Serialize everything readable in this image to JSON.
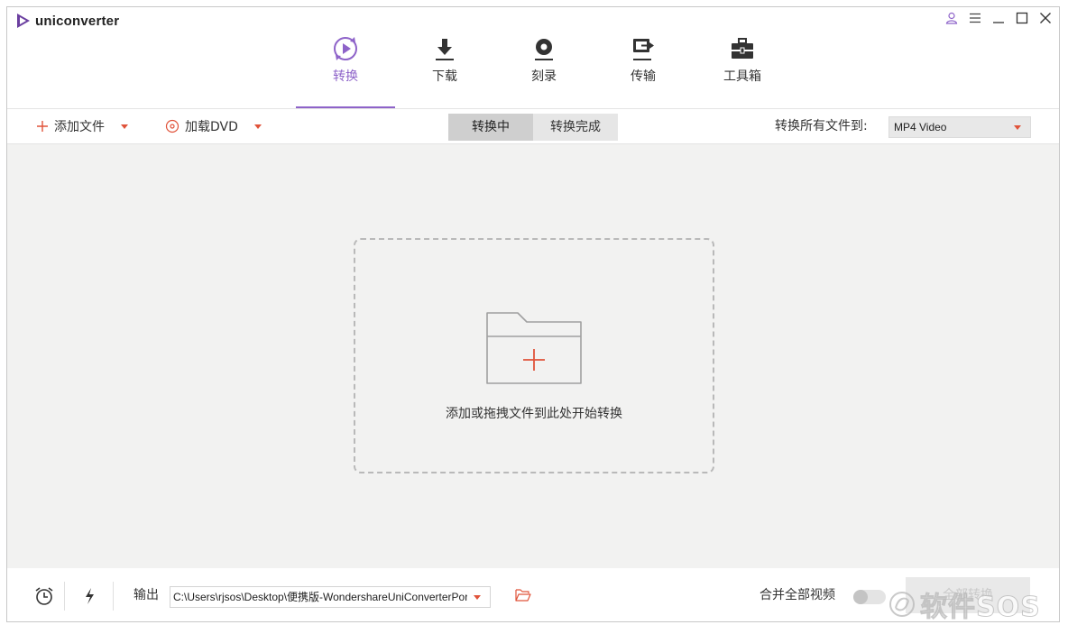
{
  "app": {
    "title": "uniconverter"
  },
  "colors": {
    "accent": "#8e63c9",
    "caret": "#e0533a",
    "plus": "#e0533a"
  },
  "window_controls": [
    {
      "name": "account-icon"
    },
    {
      "name": "menu-icon"
    },
    {
      "name": "minimize-icon"
    },
    {
      "name": "maximize-icon"
    },
    {
      "name": "close-icon"
    }
  ],
  "nav": {
    "items": [
      {
        "label": "转换",
        "icon": "convert-icon",
        "active": true
      },
      {
        "label": "下载",
        "icon": "download-icon",
        "active": false
      },
      {
        "label": "刻录",
        "icon": "burn-icon",
        "active": false
      },
      {
        "label": "传输",
        "icon": "transfer-icon",
        "active": false
      },
      {
        "label": "工具箱",
        "icon": "toolbox-icon",
        "active": false
      }
    ]
  },
  "toolbar": {
    "add_files": "添加文件",
    "load_dvd": "加载DVD",
    "tabs": {
      "converting": "转换中",
      "converted": "转换完成"
    },
    "convert_all_to_label": "转换所有文件到:",
    "format_value": "MP4 Video"
  },
  "dropzone": {
    "text": "添加或拖拽文件到此处开始转换"
  },
  "bottom": {
    "output_label": "输出",
    "output_path": "C:\\Users\\rjsos\\Desktop\\便携版-WondershareUniConverterPortable",
    "merge_label": "合并全部视频",
    "merge_enabled": false,
    "convert_all_button": "全部转换"
  },
  "watermark": {
    "text": "软件SOS"
  }
}
